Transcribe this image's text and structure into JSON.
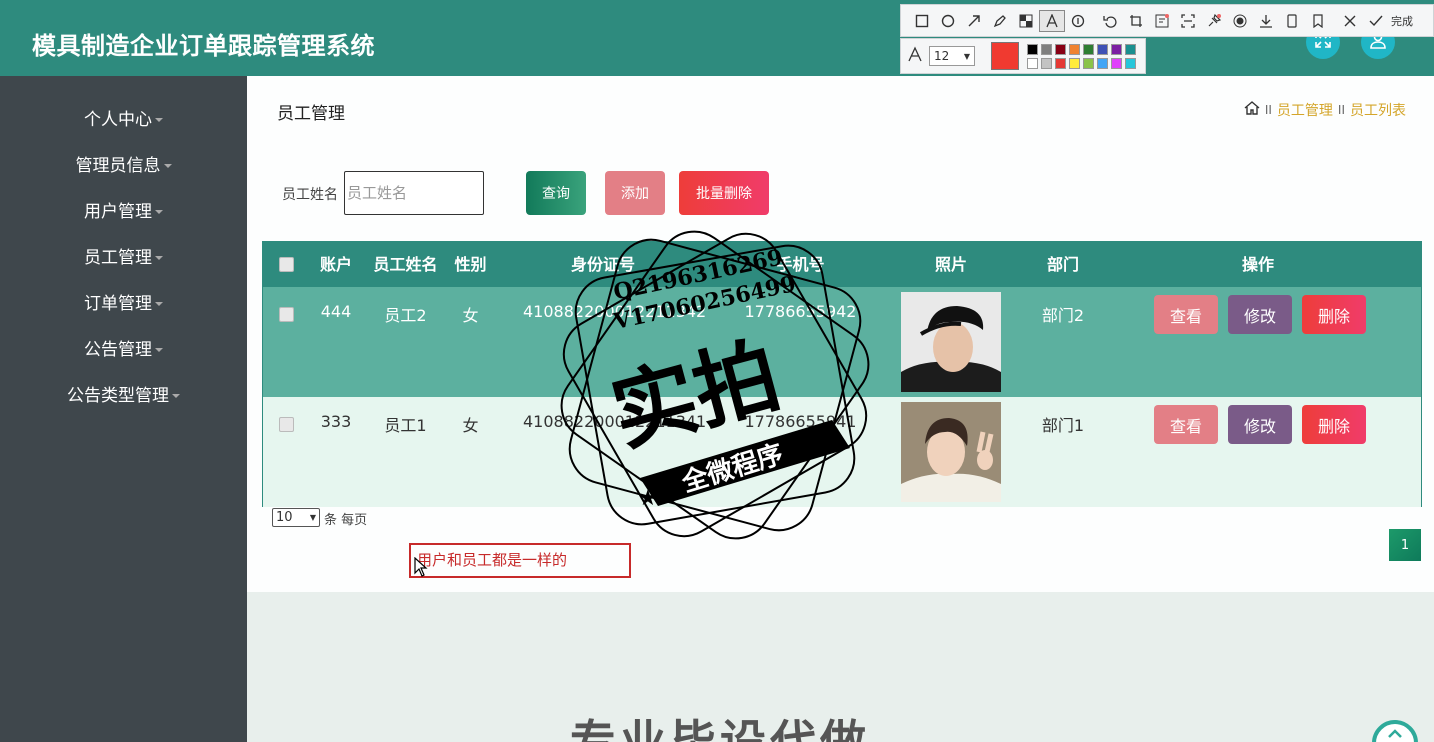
{
  "header": {
    "title": "模具制造企业订单跟踪管理系统"
  },
  "snip_toolbar": {
    "done_label": "完成",
    "font_size": "12",
    "current_color": "#f03a30",
    "palette": [
      "#000000",
      "#7f7f7f",
      "#880015",
      "#f08330",
      "#2e7d32",
      "#3f51b5",
      "#7b1fa2",
      "#1a8f8f",
      "#ffffff",
      "#c3c3c3",
      "#e53935",
      "#ffeb3b",
      "#8bc34a",
      "#42a5f5",
      "#e040fb",
      "#26c6da"
    ]
  },
  "sidebar": {
    "items": [
      {
        "label": "个人中心"
      },
      {
        "label": "管理员信息"
      },
      {
        "label": "用户管理"
      },
      {
        "label": "员工管理"
      },
      {
        "label": "订单管理"
      },
      {
        "label": "公告管理"
      },
      {
        "label": "公告类型管理"
      }
    ]
  },
  "page": {
    "title": "员工管理",
    "breadcrumb": [
      "员工管理",
      "员工列表"
    ],
    "breadcrumb_sep": "II"
  },
  "search": {
    "label": "员工姓名",
    "placeholder": "员工姓名",
    "query_label": "查询",
    "add_label": "添加",
    "batch_delete_label": "批量删除"
  },
  "table": {
    "columns": [
      "账户",
      "员工姓名",
      "性别",
      "身份证号",
      "手机号",
      "照片",
      "部门",
      "操作"
    ],
    "rows": [
      {
        "account": "444",
        "name": "员工2",
        "gender": "女",
        "id_card": "410882200012211342",
        "phone": "17786655942",
        "dept": "部门2"
      },
      {
        "account": "333",
        "name": "员工1",
        "gender": "女",
        "id_card": "410882200012211341",
        "phone": "17786655941",
        "dept": "部门1"
      }
    ],
    "view_label": "查看",
    "edit_label": "修改",
    "delete_label": "删除"
  },
  "pager": {
    "page_size": "10",
    "per_page_text": "条 每页",
    "current_page": "1"
  },
  "annotation": {
    "text": "用户和员工都是一样的"
  },
  "banner": {
    "text": "专业毕设代做"
  },
  "watermark": {
    "line1": "Q2196316269",
    "line2": "V17060256499",
    "main": "实拍",
    "sub": "全微程序"
  }
}
